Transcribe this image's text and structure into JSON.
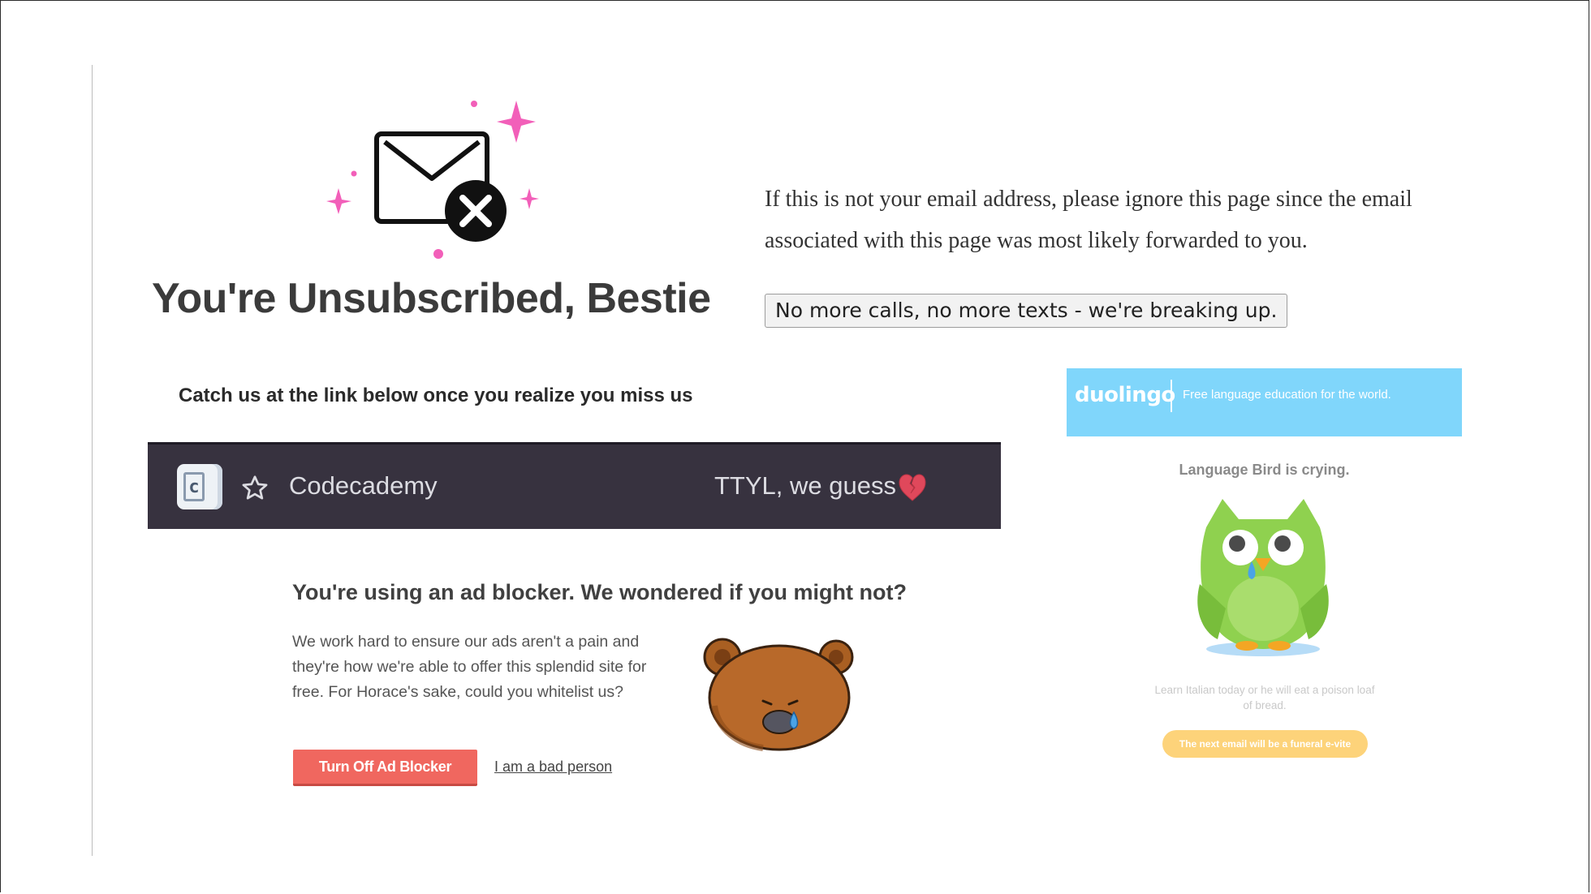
{
  "header": {
    "title": "You're Unsubscribed, Bestie",
    "notice": "If this is not your email address, please ignore this page since the email associated with this page was most likely forwarded to you.",
    "breakup_button": "No more calls, no more texts - we're breaking up."
  },
  "catch_line": "Catch us at the link below once you realize you miss us",
  "codecademy": {
    "logo_letter": "c",
    "name": "Codecademy",
    "message": "TTYL, we guess",
    "icons": [
      "codecademy-logo",
      "star-icon",
      "broken-heart-icon"
    ]
  },
  "adblock": {
    "title": "You're using an ad blocker. We wondered if you might not?",
    "body": "We work hard to ensure our ads aren't a pain and they're how we're able to offer this splendid site for free. For Horace's sake, could you whitelist us?",
    "primary_button": "Turn Off Ad Blocker",
    "secondary_link": "I am a bad person",
    "accent": "#f0675f"
  },
  "duolingo": {
    "logo": "duolingo",
    "tagline": "Free language education for the world.",
    "crying_text": "Language Bird is crying.",
    "small_text": "Learn Italian today or he will eat a poison loaf of bread.",
    "button": "The next email will be a funeral e-vite",
    "banner_color": "#80d6fb",
    "button_color": "#fdd37a"
  },
  "colors": {
    "sparkle": "#f25fb9",
    "owl_green": "#8fd14f"
  }
}
